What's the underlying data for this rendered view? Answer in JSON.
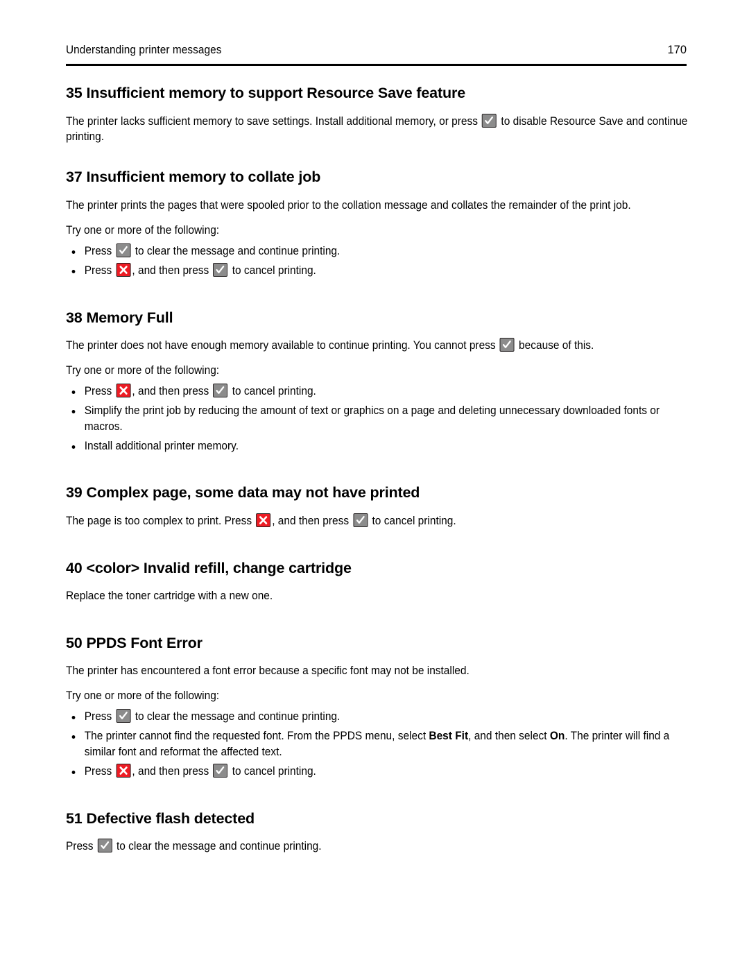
{
  "header": {
    "title": "Understanding printer messages",
    "page_number": "170"
  },
  "icons": {
    "check": {
      "name": "check-key-icon",
      "fill": "#8c8c8c",
      "glyph": "✓",
      "border": "#231f20"
    },
    "stop": {
      "name": "stop-key-icon",
      "fill": "#ed1c24",
      "glyph": "✕",
      "border": "#231f20"
    }
  },
  "sections": [
    {
      "id": "err-35",
      "heading": "35 Insufficient memory to support Resource Save feature",
      "paragraph_a": "The printer lacks sufficient memory to save settings. Install additional memory, or press",
      "paragraph_b": "to disable Resource Save and continue printing."
    },
    {
      "id": "err-37",
      "heading": "37 Insufficient memory to collate job",
      "paragraph": "The printer prints the pages that were spooled prior to the collation message and collates the remainder of the print job.",
      "intro": "Try one or more of the following:",
      "bullets": [
        {
          "pre": "Press",
          "post": "to clear the message and continue printing."
        },
        {
          "pre": "Press",
          "mid": ", and then press",
          "post": "to cancel printing."
        }
      ]
    },
    {
      "id": "err-38",
      "heading": "38 Memory Full",
      "paragraph_a": "The printer does not have enough memory available to continue printing. You cannot press",
      "paragraph_b": "because of this.",
      "intro": "Try one or more of the following:",
      "bullets": [
        {
          "pre": "Press",
          "mid": ", and then press",
          "post": "to cancel printing."
        },
        {
          "text": "Simplify the print job by reducing the amount of text or graphics on a page and deleting unnecessary downloaded fonts or macros."
        },
        {
          "text": "Install additional printer memory."
        }
      ]
    },
    {
      "id": "err-39",
      "heading": "39 Complex page, some data may not have printed",
      "paragraph_a": "The page is too complex to print. Press",
      "paragraph_b": ", and then press",
      "paragraph_c": "to cancel printing."
    },
    {
      "id": "err-40",
      "heading": "40 <color> Invalid refill, change cartridge",
      "paragraph": "Replace the toner cartridge with a new one."
    },
    {
      "id": "err-50",
      "heading": "50 PPDS Font Error",
      "paragraph": "The printer has encountered a font error because a specific font may not be installed.",
      "intro": "Try one or more of the following:",
      "bullets": [
        {
          "pre": "Press",
          "post": "to clear the message and continue printing."
        },
        {
          "text_a": "The printer cannot find the requested font. From the PPDS menu, select",
          "bold_a": "Best Fit",
          "text_b": ", and then select",
          "bold_b": "On",
          "text_c": ". The printer will find a similar font and reformat the affected text."
        },
        {
          "pre": "Press",
          "mid": ", and then press",
          "post": "to cancel printing."
        }
      ]
    },
    {
      "id": "err-51",
      "heading": "51 Defective flash detected",
      "paragraph_a": "Press",
      "paragraph_b": "to clear the message and continue printing."
    }
  ]
}
